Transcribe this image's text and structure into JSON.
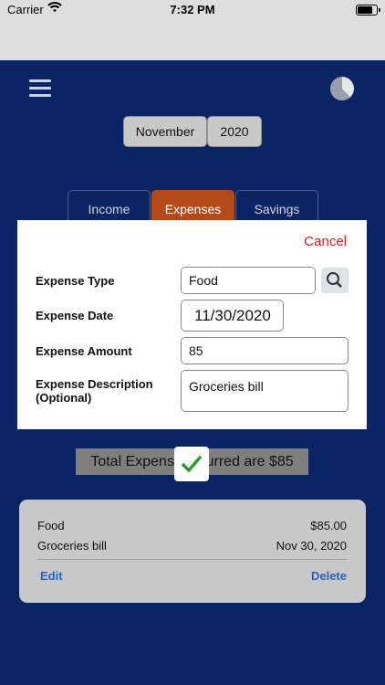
{
  "status_bar": {
    "carrier": "Carrier",
    "time": "7:32 PM",
    "battery_level": 0.9
  },
  "header": {
    "month": "November",
    "year": "2020"
  },
  "tabs": [
    "Income",
    "Expenses",
    "Savings"
  ],
  "active_tab": "Expenses",
  "modal": {
    "cancel_label": "Cancel",
    "fields": {
      "type_label": "Expense Type",
      "type_value": "Food",
      "date_label": "Expense Date",
      "date_value": "11/30/2020",
      "amount_label": "Expense Amount",
      "amount_value": "85",
      "description_label_line1": "Expense Description",
      "description_label_line2": "(Optional)",
      "description_value": "Groceries bill"
    }
  },
  "total_message": "Total Expens      curred are $85",
  "entry": {
    "category": "Food",
    "amount": "$85.00",
    "description": "Groceries bill",
    "date": "Nov 30, 2020",
    "edit_label": "Edit",
    "delete_label": "Delete"
  },
  "colors": {
    "background": "#0b2463",
    "accent": "#b44a1a",
    "cancel": "#d81e1e",
    "link": "#2b62b8",
    "check": "#2e9a2e"
  },
  "icons": [
    "wifi-icon",
    "battery-icon",
    "hamburger-menu-icon",
    "pie-chart-icon",
    "search-icon",
    "checkmark-icon"
  ]
}
